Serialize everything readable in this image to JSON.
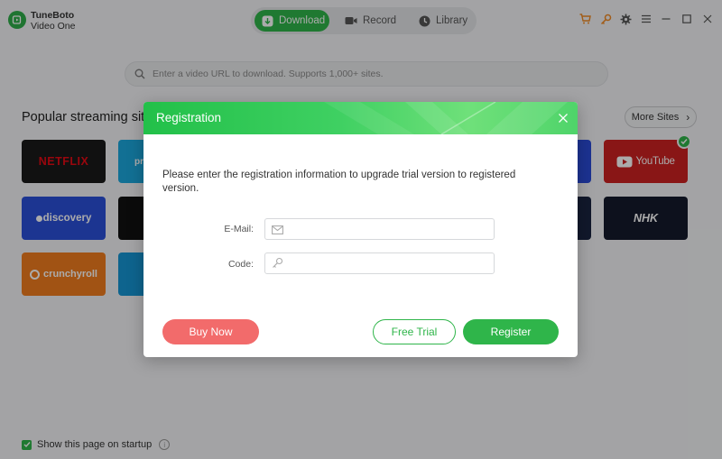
{
  "app": {
    "name_line1": "TuneBoto",
    "name_line2": "Video One"
  },
  "nav": {
    "tabs": [
      {
        "label": "Download",
        "icon": "download-icon",
        "active": true
      },
      {
        "label": "Record",
        "icon": "record-icon",
        "active": false
      },
      {
        "label": "Library",
        "icon": "clock-icon",
        "active": false
      }
    ]
  },
  "toolbar": {
    "icons": [
      "cart-icon",
      "key-icon",
      "gear-icon",
      "menu-icon",
      "minimize-icon",
      "maximize-icon",
      "close-icon"
    ],
    "accent_color": "#f08a24"
  },
  "search": {
    "placeholder": "Enter a video URL to download. Supports 1,000+ sites."
  },
  "section": {
    "title": "Popular streaming sit",
    "more_label": "More Sites",
    "more_chevron": "›"
  },
  "sites": [
    {
      "label": "NETFLIX",
      "color": "#1a1a1a",
      "text_color": "#e50914"
    },
    {
      "label": "pr",
      "color": "#1ba8dd"
    },
    {
      "label": "",
      "color": "#2a4bd8"
    },
    {
      "label": "YouTube",
      "color": "#cc2222",
      "checked": true
    },
    {
      "label": "discovery",
      "color": "#2b4fd9"
    },
    {
      "label": "",
      "color": "#111111"
    },
    {
      "label": "",
      "color": "#1a2540"
    },
    {
      "label": "NHK",
      "color": "#141a2c"
    },
    {
      "label": "crunchyroll",
      "color": "#f07c1e"
    },
    {
      "label": "",
      "color": "#1596d4"
    }
  ],
  "footer": {
    "startup_label": "Show this page on startup",
    "startup_checked": true,
    "info_glyph": "i"
  },
  "dialog": {
    "title": "Registration",
    "message": "Please enter the registration information to upgrade trial version to registered version.",
    "email_label": "E-Mail:",
    "email_value": "",
    "code_label": "Code:",
    "code_value": "",
    "buy_label": "Buy Now",
    "trial_label": "Free Trial",
    "register_label": "Register",
    "colors": {
      "primary": "#2fb54a",
      "buy": "#f26b6b"
    }
  }
}
